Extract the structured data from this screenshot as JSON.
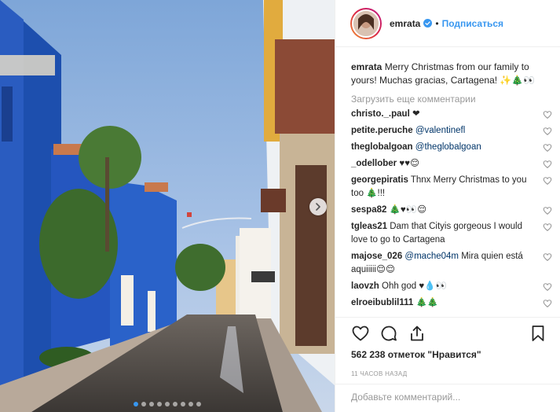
{
  "post": {
    "username": "emrata",
    "separator": "•",
    "follow_label": "Подписаться",
    "caption_user": "emrata",
    "caption_text": "Merry Christmas from our family to yours! Muchas gracias, Cartagena! ✨🎄👀",
    "load_more": "Загрузить еще комментарии",
    "likes": "562 238 отметок \"Нравится\"",
    "time": "11 ЧАСОВ НАЗАД",
    "add_comment_placeholder": "Добавьте комментарий..."
  },
  "comments": [
    {
      "user": "christo._.paul",
      "text": "❤"
    },
    {
      "user": "petite.peruche",
      "mention": "@valentinefl",
      "text": ""
    },
    {
      "user": "theglobalgoan",
      "mention": "@theglobalgoan",
      "text": ""
    },
    {
      "user": "_odellober",
      "text": "♥♥😌"
    },
    {
      "user": "georgepiratis",
      "text": "Thnx Merry Christmas to you too 🎄!!!"
    },
    {
      "user": "sespa82",
      "text": "🎄♥👀😌"
    },
    {
      "user": "tgleas21",
      "text": "Dam that Cityis gorgeous I would love to go to Cartagena"
    },
    {
      "user": "majose_026",
      "mention": "@mache04m",
      "text": "Mira quien está aquiiiii😌😌"
    },
    {
      "user": "laovzh",
      "text": "Ohh god ♥💧👀"
    },
    {
      "user": "elroeibublil111",
      "text": "🎄🎄"
    }
  ],
  "icons": {
    "verified": "verified-badge-icon",
    "heart": "heart-icon",
    "comment": "comment-bubble-icon",
    "share": "share-icon",
    "save": "bookmark-icon",
    "next": "chevron-right-icon"
  },
  "colors": {
    "accent": "#3897f0",
    "muted": "#999999",
    "text": "#262626",
    "mention": "#003569"
  },
  "carousel": {
    "count": 9,
    "active": 1
  }
}
